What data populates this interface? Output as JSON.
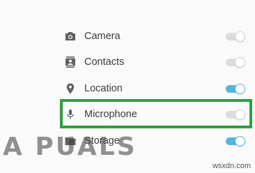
{
  "permissions": [
    {
      "icon": "camera-icon",
      "label": "Camera",
      "enabled": false
    },
    {
      "icon": "contacts-icon",
      "label": "Contacts",
      "enabled": false
    },
    {
      "icon": "location-icon",
      "label": "Location",
      "enabled": true
    },
    {
      "icon": "microphone-icon",
      "label": "Microphone",
      "enabled": false
    },
    {
      "icon": "storage-folder-icon",
      "label": "Storage",
      "enabled": true
    }
  ],
  "colors": {
    "toggle_on": "#56b4dd",
    "toggle_off": "#dcdcdc",
    "highlight": "#2e9e3e"
  },
  "watermark": {
    "text": "A PUALS"
  },
  "site_credit": "wsxdn.com"
}
